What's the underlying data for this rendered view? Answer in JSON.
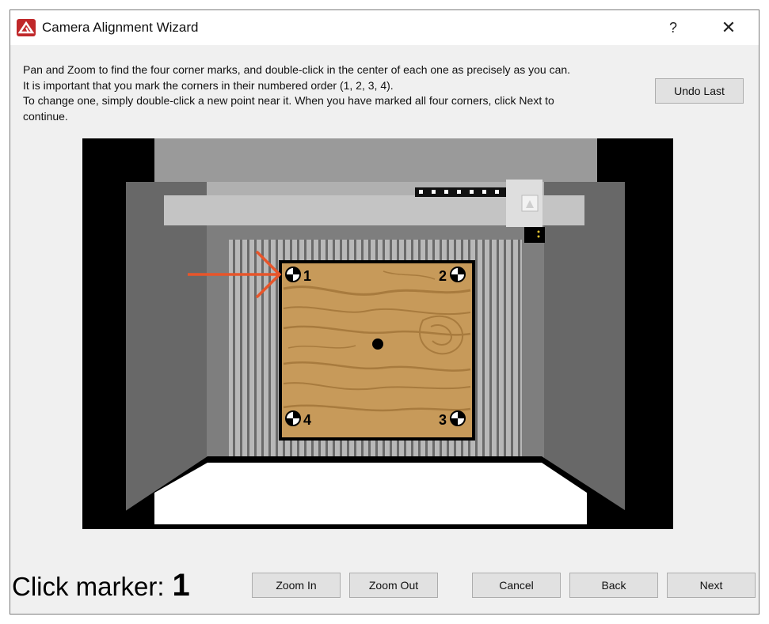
{
  "window": {
    "title": "Camera Alignment Wizard",
    "help_label": "?",
    "close_label": "✕"
  },
  "instructions": [
    "Pan and Zoom to find the four corner marks, and double-click in the center of each one as precisely as you can.",
    "It is important that you mark the corners in their numbered order (1, 2, 3, 4).",
    "To change one, simply double-click a new point near it.  When you have marked all four corners, click Next to",
    "continue."
  ],
  "buttons": {
    "undo_last": "Undo Last",
    "zoom_in": "Zoom In",
    "zoom_out": "Zoom Out",
    "cancel": "Cancel",
    "back": "Back",
    "next": "Next"
  },
  "status": {
    "label": "Click marker:",
    "current_marker": "1"
  },
  "markers": {
    "m1": "1",
    "m2": "2",
    "m3": "3",
    "m4": "4"
  },
  "colors": {
    "arrow": "#e8552a",
    "wood": "#c79a5a",
    "grain": "#a87b3e",
    "app_icon": "#c0282a"
  },
  "icons": {
    "app": "app-logo-icon",
    "help": "help-icon",
    "close": "close-icon",
    "arrow": "pointer-arrow-icon"
  }
}
